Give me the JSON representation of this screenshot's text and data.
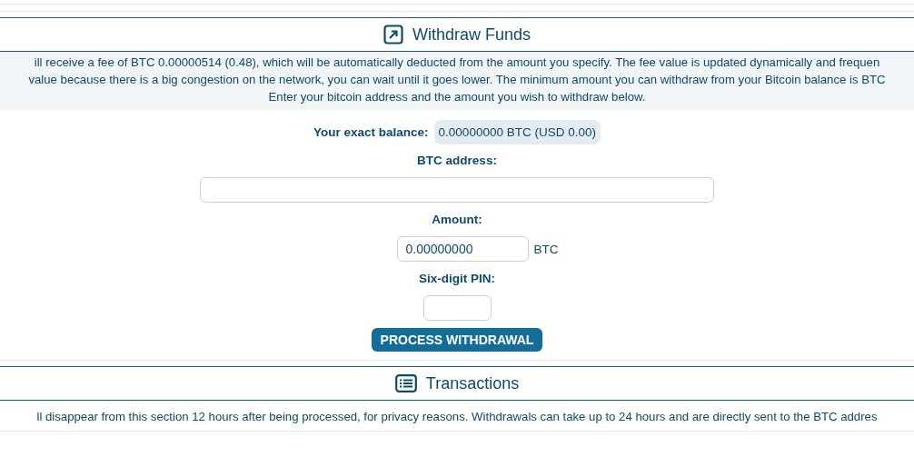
{
  "withdraw": {
    "title": "Withdraw Funds",
    "info": [
      "ill receive a fee of BTC 0.00000514 (0.48), which will be automatically deducted from the amount you specify. The fee value is updated dynamically and frequen",
      "value because there is a big congestion on the network, you can wait until it goes lower. The minimum amount you can withdraw from your Bitcoin balance is BTC",
      "Enter your bitcoin address and the amount you wish to withdraw below."
    ],
    "balance_label": "Your exact balance:",
    "balance_value": "0.00000000 BTC (USD 0.00)",
    "address_label": "BTC address:",
    "amount_label": "Amount:",
    "amount_value": "0.00000000",
    "amount_unit": "BTC",
    "pin_label": "Six-digit PIN:",
    "button": "PROCESS WITHDRAWAL"
  },
  "transactions": {
    "title": "Transactions",
    "info": "ll disappear from this section 12 hours after being processed, for privacy reasons. Withdrawals can take up to 24 hours and are directly sent to the BTC addres"
  }
}
